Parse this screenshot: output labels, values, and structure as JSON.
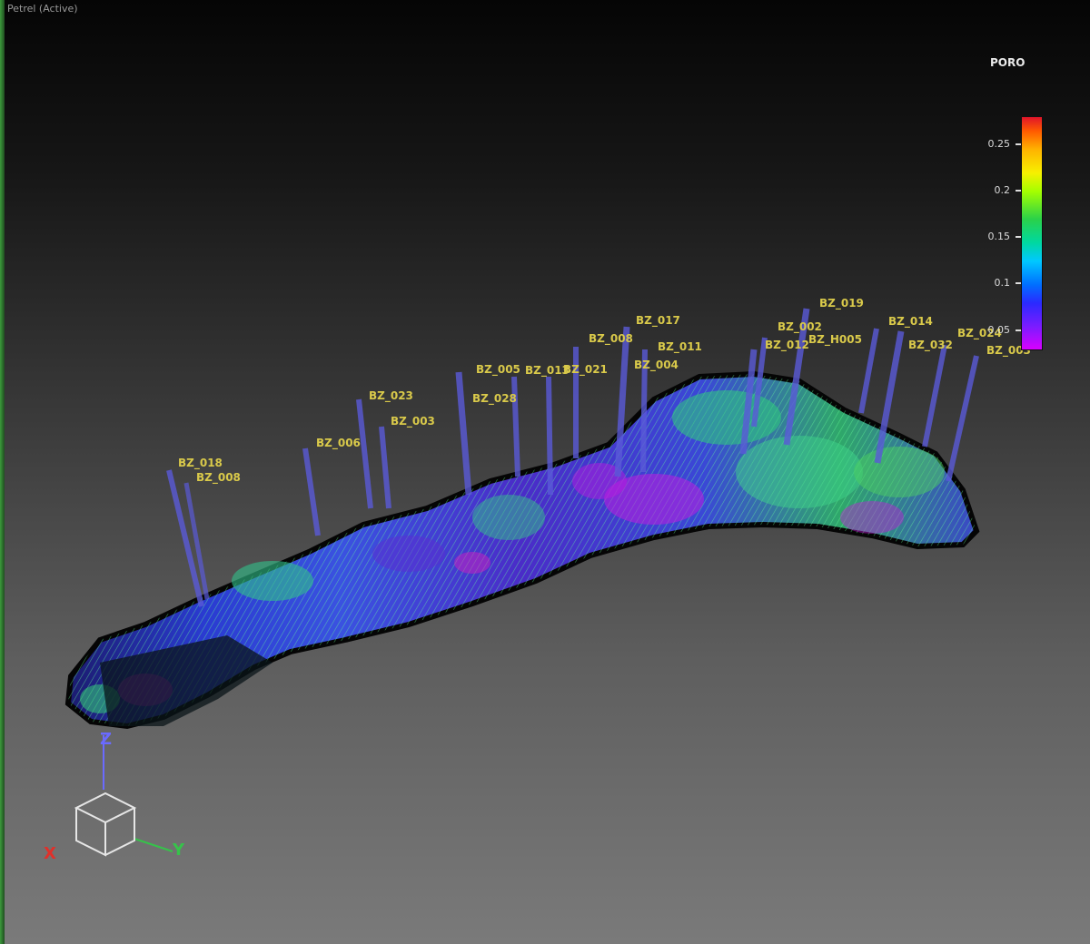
{
  "window": {
    "title": "Petrel (Active)"
  },
  "property": {
    "name": "PORO"
  },
  "colorbar": {
    "ticks": [
      {
        "label": "0.25",
        "value": 0.25
      },
      {
        "label": "0.2",
        "value": 0.2
      },
      {
        "label": "0.15",
        "value": 0.15
      },
      {
        "label": "0.1",
        "value": 0.1
      },
      {
        "label": "0.05",
        "value": 0.05
      }
    ],
    "colors": {
      "high": "#e0142a",
      "mid": "#2ad14a",
      "low": "#d800ff"
    }
  },
  "wells": [
    {
      "label": "BZ_018"
    },
    {
      "label": "BZ_008"
    },
    {
      "label": "BZ_006"
    },
    {
      "label": "BZ_023"
    },
    {
      "label": "BZ_003"
    },
    {
      "label": "BZ_005"
    },
    {
      "label": "BZ_028"
    },
    {
      "label": "BZ_013"
    },
    {
      "label": "BZ_021"
    },
    {
      "label": "BZ_008"
    },
    {
      "label": "BZ_017"
    },
    {
      "label": "BZ_011"
    },
    {
      "label": "BZ_004"
    },
    {
      "label": "BZ_019"
    },
    {
      "label": "BZ_002"
    },
    {
      "label": "BZ_012"
    },
    {
      "label": "BZ_H005"
    },
    {
      "label": "BZ_014"
    },
    {
      "label": "BZ_032"
    },
    {
      "label": "BZ_024"
    },
    {
      "label": "BZ_003"
    }
  ],
  "axes": {
    "z": "Z",
    "y": "Y",
    "x": "X",
    "colors": {
      "z": "#6a6aff",
      "y": "#36c24a",
      "x": "#e0302a"
    }
  },
  "icons": {
    "view-cube": "view-cube-icon"
  }
}
